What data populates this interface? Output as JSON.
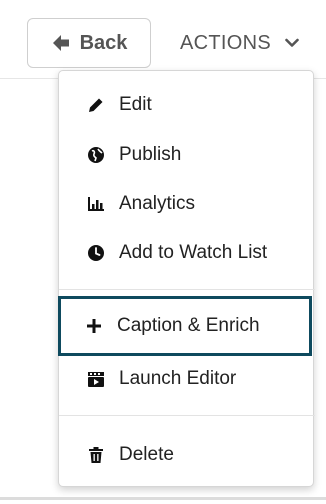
{
  "header": {
    "back_label": "Back",
    "actions_label": "ACTIONS"
  },
  "menu": {
    "items": [
      {
        "label": "Edit",
        "icon": "pencil-icon"
      },
      {
        "label": "Publish",
        "icon": "globe-icon"
      },
      {
        "label": "Analytics",
        "icon": "bar-chart-icon"
      },
      {
        "label": "Add to Watch List",
        "icon": "clock-icon"
      },
      {
        "label": "Caption & Enrich",
        "icon": "plus-icon"
      },
      {
        "label": "Launch Editor",
        "icon": "clapperboard-icon"
      },
      {
        "label": "Delete",
        "icon": "trash-icon"
      }
    ]
  },
  "colors": {
    "highlight_border": "#0e4a5e",
    "text": "#222222",
    "muted_text": "#555555"
  }
}
